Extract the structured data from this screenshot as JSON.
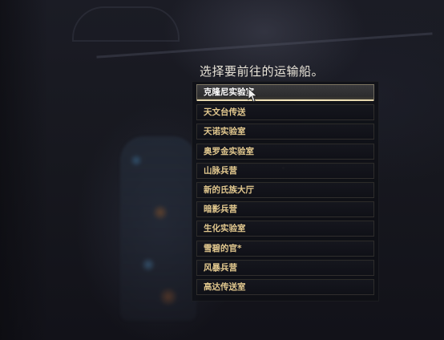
{
  "dialog": {
    "prompt": "选择要前往的运输船。",
    "selected_index": 0,
    "options": [
      {
        "label": "克隆尼实验室"
      },
      {
        "label": "天文台传送"
      },
      {
        "label": "天诺实验室"
      },
      {
        "label": "奥罗金实验室"
      },
      {
        "label": "山脉兵营"
      },
      {
        "label": "新的氏族大厅"
      },
      {
        "label": "暗影兵营"
      },
      {
        "label": "生化实验室"
      },
      {
        "label": "雪碧的官*"
      },
      {
        "label": "风暴兵营"
      },
      {
        "label": "高达传送室"
      }
    ]
  },
  "colors": {
    "option_text": "#e3c98f",
    "selected_text": "#ffffff",
    "selected_underline": "#f6e7bd",
    "prompt_text": "#e9e4d8"
  },
  "icons": {
    "cursor": "mouse-pointer-icon"
  }
}
